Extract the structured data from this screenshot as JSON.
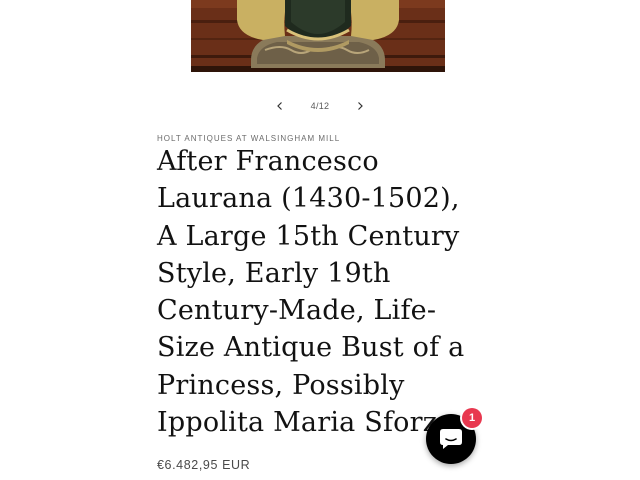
{
  "gallery": {
    "image_alt": "Antique bust of a princess",
    "counter": "4/12"
  },
  "product": {
    "vendor": "HOLT ANTIQUES AT WALSINGHAM MILL",
    "title": "After Francesco Laurana (1430-1502), A Large 15th Century Style, Early 19th Century-Made, Life-Size Antique Bust of a Princess, Possibly Ippolita Maria Sforza",
    "price": "€6.482,95 EUR"
  },
  "chat": {
    "badge_count": "1",
    "icon": "chat-bubble-icon"
  },
  "colors": {
    "badge": "#e8384f",
    "chat_button": "#000000",
    "text": "#121212"
  }
}
